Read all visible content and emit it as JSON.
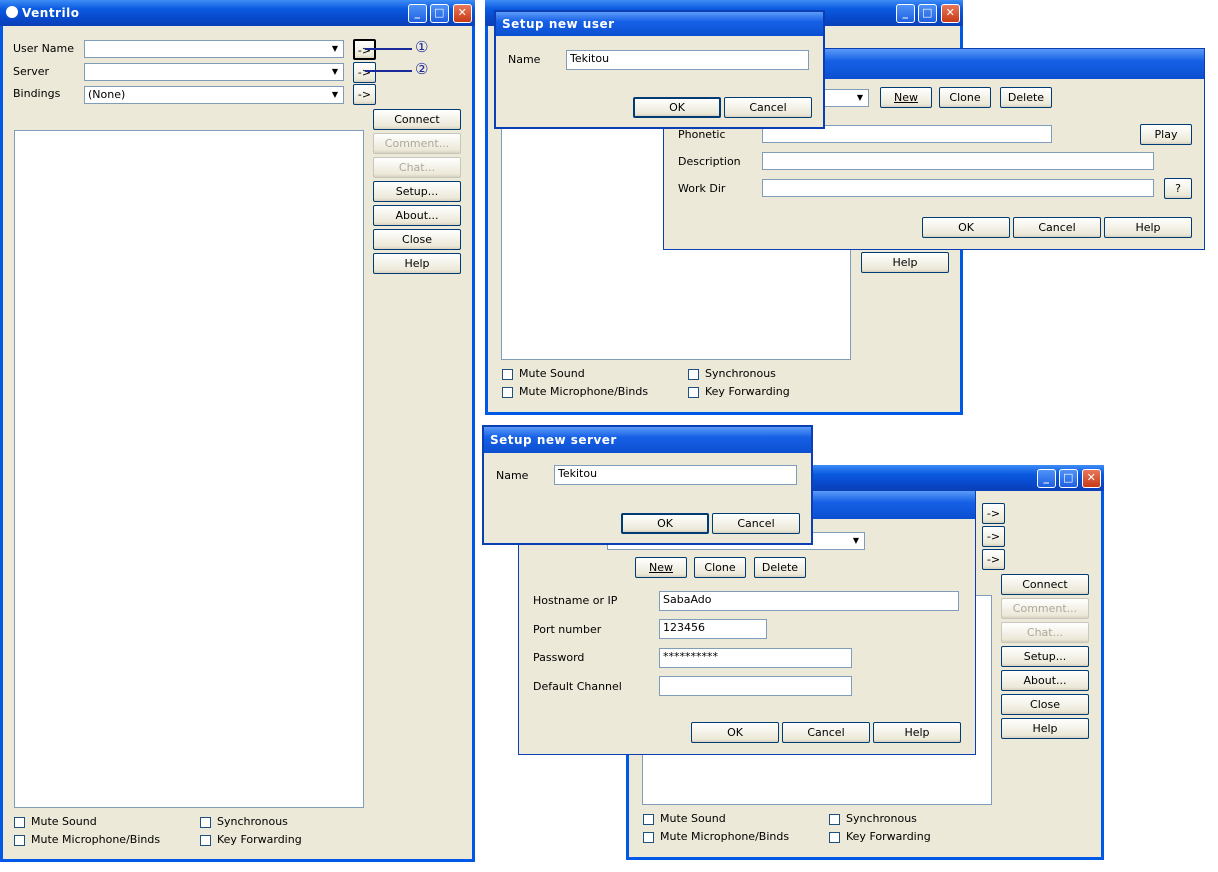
{
  "main": {
    "title": "Ventrilo",
    "user_name_label": "User Name",
    "server_label": "Server",
    "bindings_label": "Bindings",
    "bindings_value": "(None)",
    "arrow": "->",
    "buttons": {
      "connect": "Connect",
      "comment": "Comment...",
      "chat": "Chat...",
      "setup": "Setup...",
      "about": "About...",
      "close": "Close",
      "help": "Help"
    },
    "mute_sound": "Mute Sound",
    "mute_mic": "Mute Microphone/Binds",
    "synchronous": "Synchronous",
    "key_forwarding": "Key Forwarding"
  },
  "annotations": {
    "one": "①",
    "two": "②"
  },
  "user_setup": {
    "new": "New",
    "clone": "Clone",
    "delete": "Delete",
    "phonetic": "Phonetic",
    "description": "Description",
    "work_dir": "Work Dir",
    "play": "Play",
    "question": "?",
    "ok": "OK",
    "cancel": "Cancel",
    "help": "Help"
  },
  "setup_new_user": {
    "title": "Setup new user",
    "name_label": "Name",
    "name_value": "Tekitou",
    "ok": "OK",
    "cancel": "Cancel"
  },
  "setup_new_server": {
    "title": "Setup new server",
    "name_label": "Name",
    "name_value": "Tekitou",
    "ok": "OK",
    "cancel": "Cancel"
  },
  "server_setup": {
    "new": "New",
    "clone": "Clone",
    "delete": "Delete",
    "hostname_label": "Hostname or IP",
    "hostname_value": "SabaAdo",
    "port_label": "Port number",
    "port_value": "123456",
    "password_label": "Password",
    "password_value": "**********",
    "channel_label": "Default Channel",
    "channel_value": "",
    "ok": "OK",
    "cancel": "Cancel",
    "help": "Help"
  }
}
